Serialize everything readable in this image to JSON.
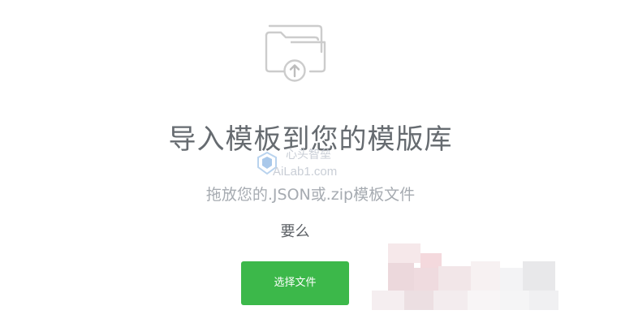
{
  "import_panel": {
    "icon": "folder-upload-icon",
    "title": "导入模板到您的模版库",
    "subtitle": "拖放您的.JSON或.zip模板文件",
    "or_text": "要么",
    "select_button_label": "选择文件"
  },
  "watermark": {
    "cn_text": "心头智垒",
    "en_text": "AiLab1.com"
  },
  "colors": {
    "button_bg": "#3cb84a",
    "title": "#666b70",
    "subtitle": "#a6abb1",
    "icon_stroke": "#c8c8c8",
    "watermark": "#c9ced6"
  }
}
